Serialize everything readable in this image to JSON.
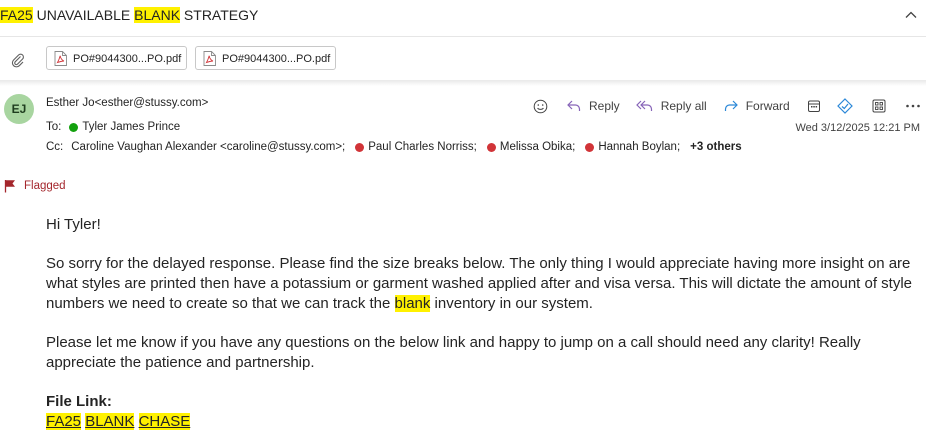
{
  "subject": {
    "part1": "FA25",
    "part2": " UNAVAILABLE ",
    "part3": "BLANK",
    "part4": " STRATEGY"
  },
  "attachments": [
    {
      "name": "PO#9044300...PO.pdf"
    },
    {
      "name": "PO#9044300...PO.pdf"
    }
  ],
  "sender": {
    "initials": "EJ",
    "display": "Esther Jo<esther@stussy.com>",
    "avatar_color": "#a8d5a0"
  },
  "to": {
    "label": "To:",
    "name": "Tyler James Prince"
  },
  "cc": {
    "label": "Cc:",
    "first": "Caroline Vaughan Alexander <caroline@stussy.com>;",
    "others": [
      "Paul Charles Norriss;",
      "Melissa Obika;",
      "Hannah Boylan;"
    ],
    "more": "+3 others"
  },
  "date": "Wed 3/12/2025 12:21 PM",
  "actions": {
    "reply": "Reply",
    "reply_all": "Reply all",
    "forward": "Forward"
  },
  "flag": {
    "label": "Flagged",
    "color": "#a4262c"
  },
  "body": {
    "greeting": "Hi Tyler!",
    "para1_a": "So sorry for the delayed response.  Please find the size breaks below.  The only thing I would appreciate having more insight on are what styles are printed then have a potassium or garment washed applied after and visa versa.   This will dictate the amount of style numbers we need to create so that we can track the ",
    "para1_hl": "blank",
    "para1_b": " inventory in our system.",
    "para2": "Please let me know if you have any questions on the below link and happy to jump on a call should need any clarity!  Really appreciate the patience and partnership.",
    "file_label": "File Link:",
    "link_w1": "FA25",
    "link_w2": "BLANK",
    "link_w3": "CHASE"
  },
  "colors": {
    "highlight": "#fff100",
    "presence_available": "#13a10e",
    "presence_busy": "#d13438"
  }
}
